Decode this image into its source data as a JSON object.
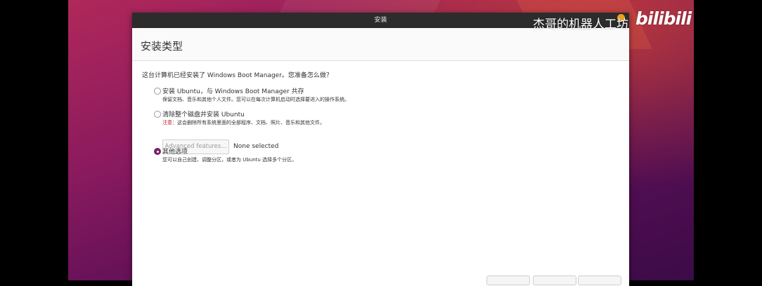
{
  "window": {
    "title": "安装"
  },
  "page_title": "安装类型",
  "question": "这台计算机已经安装了 Windows Boot Manager。您准备怎么做？",
  "options": [
    {
      "label": "安装 Ubuntu，与 Windows Boot Manager 共存",
      "description": "保留文档、音乐和其他个人文件。您可以在每次计算机启动时选择要进入的操作系统。",
      "selected": false
    },
    {
      "label": "清除整个磁盘并安装 Ubuntu",
      "warning_label": "注意",
      "description": "：这会删除所有系统里面的全部程序、文档、照片、音乐和其他文件。",
      "selected": false
    },
    {
      "label": "其他选项",
      "description": "您可以自己创建、调整分区，或者为 Ubuntu 选择多个分区。",
      "selected": true
    }
  ],
  "advanced": {
    "button_label": "Advanced features...",
    "status": "None selected"
  },
  "watermark": {
    "text": "杰哥的机器人工坊",
    "logo": "bilibili"
  },
  "colors": {
    "accent": "#77216f",
    "warning": "#c7162b",
    "titlebar": "#2c2c2c"
  }
}
